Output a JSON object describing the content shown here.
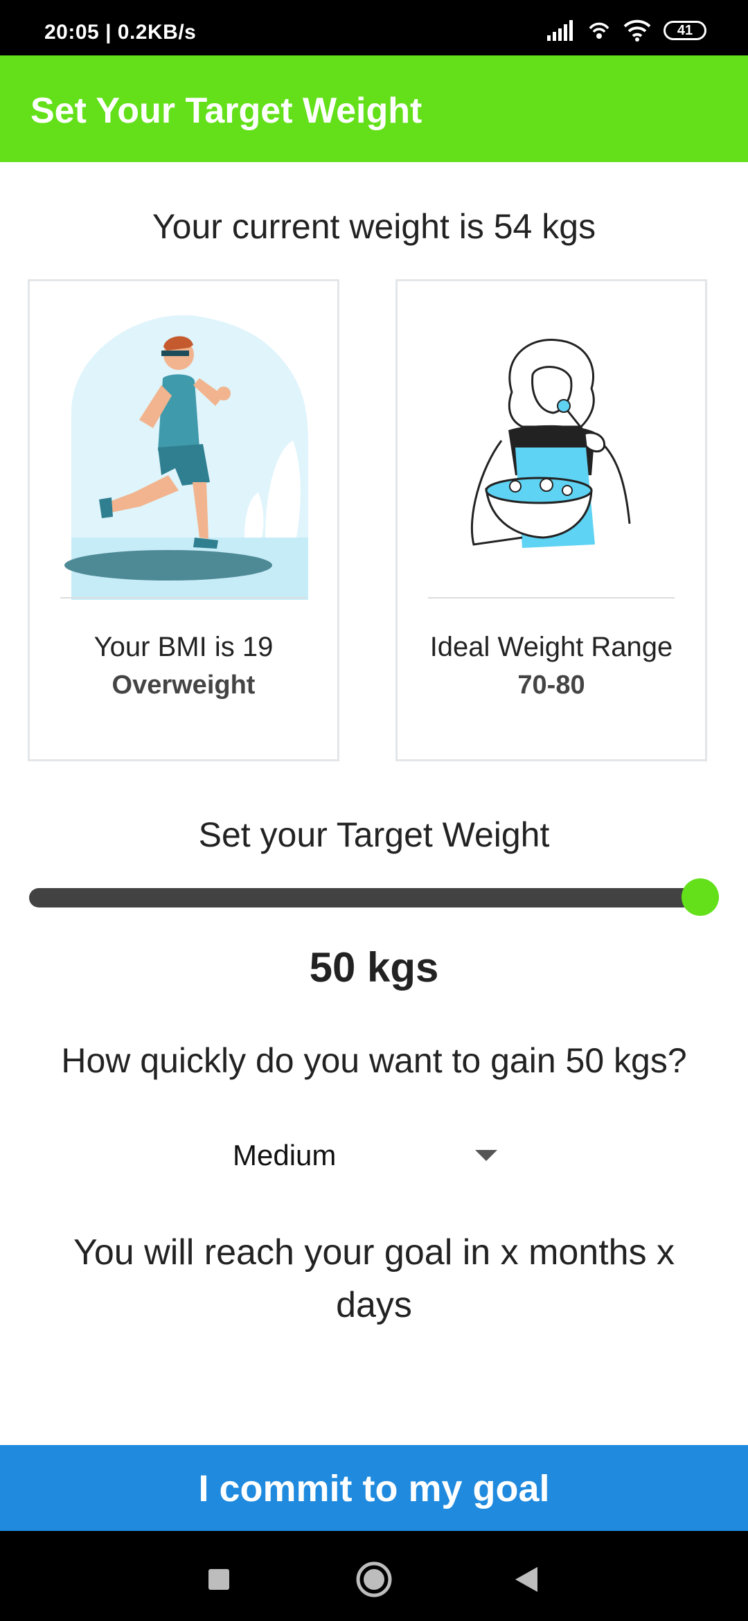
{
  "status_bar": {
    "time_speed": "20:05 | 0.2KB/s",
    "battery_level": "41"
  },
  "app_bar": {
    "title": "Set Your Target Weight"
  },
  "current_weight_text": "Your current weight is 54 kgs",
  "bmi_card": {
    "label": "Your BMI is 19",
    "status": "Overweight",
    "illustration": "runner-illustration"
  },
  "ideal_card": {
    "label": "Ideal Weight Range",
    "range": "70-80",
    "illustration": "woman-eating-salad-illustration"
  },
  "target": {
    "label": "Set your Target Weight",
    "value_text": "50 kgs",
    "slider_fraction": 1.0
  },
  "question": "How quickly do you want to gain 50 kgs?",
  "speed": {
    "selected": "Medium"
  },
  "goal_text": "You will reach your goal in x months x days",
  "commit_button": "I commit to my goal",
  "colors": {
    "accent_green": "#63e01a",
    "button_blue": "#1f8ade",
    "track": "#424242"
  },
  "nav": {
    "icons": [
      "recent-apps-icon",
      "home-icon",
      "back-icon"
    ]
  }
}
